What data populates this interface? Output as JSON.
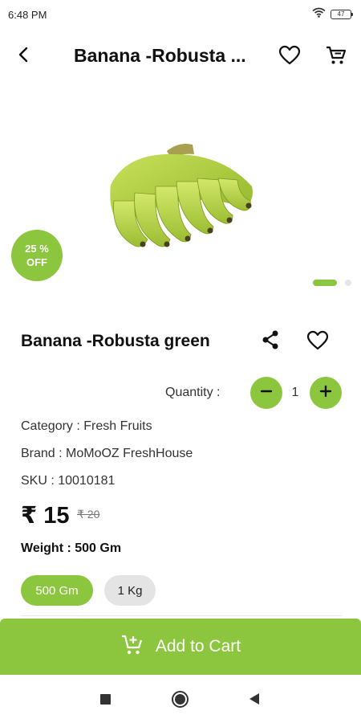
{
  "status_bar": {
    "time": "6:48 PM",
    "battery": "47",
    "icons": [
      "wifi-icon",
      "battery-icon"
    ]
  },
  "app_bar": {
    "title": "Banana -Robusta ...",
    "icons": [
      "back-arrow-icon",
      "heart-outline-icon",
      "cart-icon"
    ]
  },
  "product": {
    "image_icon": "banana-image",
    "discount_line1": "25 %",
    "discount_line2": "OFF",
    "carousel_pages": 2,
    "carousel_active": 1,
    "name": "Banana -Robusta green",
    "category": "Category : Fresh Fruits",
    "brand": "Brand : MoMoOZ FreshHouse",
    "sku": "SKU : 10010181",
    "price": "₹ 15",
    "old_price": "₹ 20",
    "weight": "Weight : 500 Gm"
  },
  "quantity": {
    "label": "Quantity :",
    "value": "1"
  },
  "variants": [
    {
      "label": "500 Gm",
      "selected": true
    },
    {
      "label": "1 Kg",
      "selected": false
    }
  ],
  "actions": {
    "add_to_cart": "Add to Cart"
  },
  "colors": {
    "accent": "#8cc63f",
    "chip_inactive": "#e4e4e4"
  }
}
